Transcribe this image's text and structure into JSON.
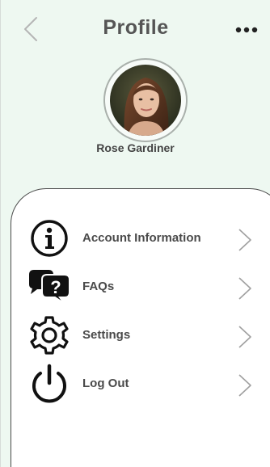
{
  "header": {
    "title": "Profile"
  },
  "profile": {
    "name": "Rose Gardiner"
  },
  "menu": {
    "items": [
      {
        "label": "Account Information",
        "icon": "info-icon"
      },
      {
        "label": "FAQs",
        "icon": "faq-chat-icon"
      },
      {
        "label": "Settings",
        "icon": "gear-icon"
      },
      {
        "label": "Log Out",
        "icon": "power-icon"
      }
    ]
  },
  "colors": {
    "header_background": "#eef8f1",
    "card_background": "#ffffff",
    "text": "#4a4a4a",
    "icon": "#111111"
  }
}
